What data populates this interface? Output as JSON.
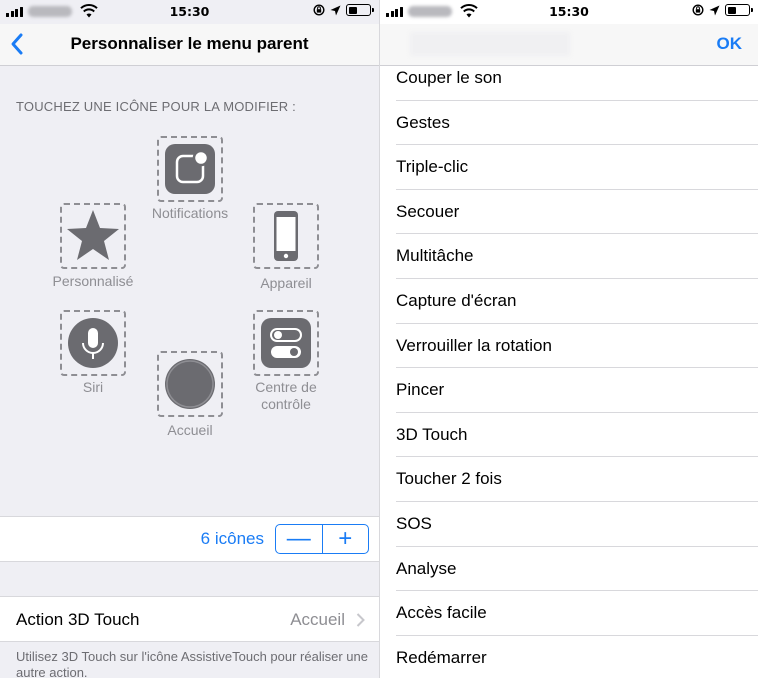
{
  "left": {
    "status": {
      "time": "15:30"
    },
    "nav": {
      "title": "Personnaliser le menu parent"
    },
    "section_header": "TOUCHEZ UNE ICÔNE POUR LA MODIFIER :",
    "icons": {
      "notifications": "Notifications",
      "custom": "Personnalisé",
      "device": "Appareil",
      "siri": "Siri",
      "control_center_1": "Centre de",
      "control_center_2": "contrôle",
      "home": "Accueil"
    },
    "count": {
      "label": "6 icônes",
      "minus": "—",
      "plus": "+"
    },
    "action": {
      "label": "Action 3D Touch",
      "value": "Accueil"
    },
    "footer_note": "Utilisez 3D Touch sur l'icône AssistiveTouch pour réaliser une autre action."
  },
  "right": {
    "status": {
      "time": "15:30"
    },
    "nav": {
      "ok": "OK"
    },
    "items": [
      "Couper le son",
      "Gestes",
      "Triple-clic",
      "Secouer",
      "Multitâche",
      "Capture d'écran",
      "Verrouiller la rotation",
      "Pincer",
      "3D Touch",
      "Toucher 2 fois",
      "SOS",
      "Analyse",
      "Accès facile",
      "Redémarrer"
    ]
  },
  "colors": {
    "accent": "#1a7cf5",
    "icon_gray": "#6b6b70",
    "label_gray": "#8e8e93",
    "background": "#efeff4"
  }
}
